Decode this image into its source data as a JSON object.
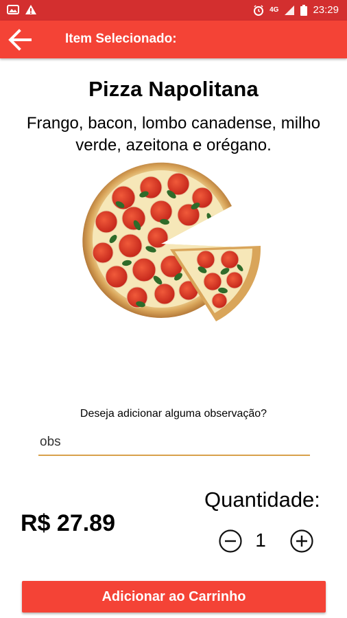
{
  "status_bar": {
    "time": "23:29",
    "icons": [
      "image-notification-icon",
      "warning-icon",
      "alarm-icon",
      "network-4g-icon",
      "signal-icon",
      "battery-icon"
    ],
    "network_label": "4G"
  },
  "app_bar": {
    "title": "Item Selecionado:",
    "back_icon": "arrow-left-icon"
  },
  "item": {
    "name": "Pizza Napolitana",
    "description": "Frango, bacon, lombo canadense, milho verde, azeitona e orégano.",
    "image": "pizza-image"
  },
  "observation": {
    "label": "Deseja adicionar alguma observação?",
    "placeholder": "obs",
    "value": ""
  },
  "price": "R$ 27.89",
  "quantity": {
    "label": "Quantidade:",
    "value": "1",
    "minus_icon": "minus-circle-icon",
    "plus_icon": "plus-circle-icon"
  },
  "cart_button": {
    "label": "Adicionar ao Carrinho"
  },
  "colors": {
    "status_bar": "#d32f2f",
    "app_bar": "#f44336",
    "button": "#f44336",
    "input_underline": "#d8a04a"
  }
}
